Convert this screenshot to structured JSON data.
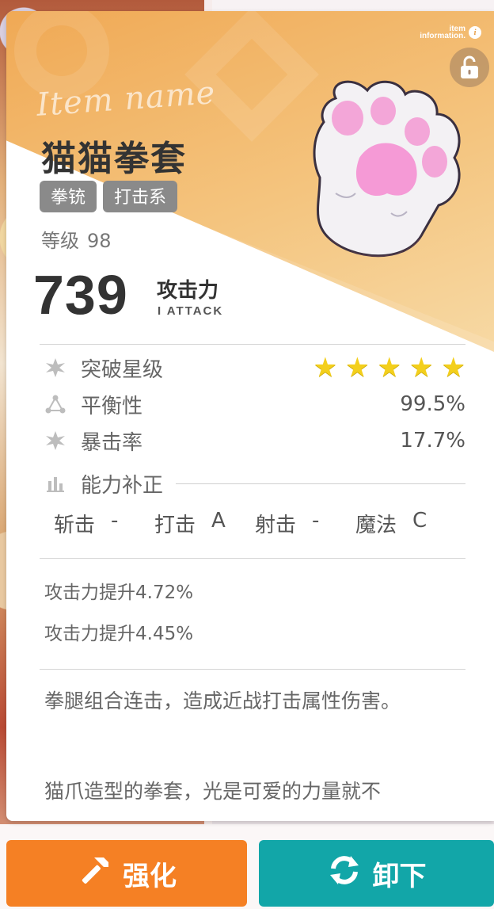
{
  "header": {
    "info_label_line1": "item",
    "info_label_line2": "information.",
    "info_icon": "i"
  },
  "item": {
    "script_label": "Item name",
    "name": "猫猫拳套",
    "tags": [
      "拳铳",
      "打击系"
    ],
    "level_label": "等级",
    "level_value": "98",
    "attack_value": "739",
    "attack_label": "攻击力",
    "attack_sublabel": "I ATTACK"
  },
  "stats": {
    "breakthrough_label": "突破星级",
    "stars": 5,
    "balance_label": "平衡性",
    "balance_value": "99.5%",
    "crit_label": "暴击率",
    "crit_value": "17.7%"
  },
  "correction": {
    "label": "能力补正",
    "items": [
      {
        "name": "斩击",
        "grade": "-"
      },
      {
        "name": "打击",
        "grade": "A"
      },
      {
        "name": "射击",
        "grade": "-"
      },
      {
        "name": "魔法",
        "grade": "C"
      }
    ]
  },
  "bonuses": [
    "攻击力提升4.72%",
    "攻击力提升4.45%"
  ],
  "description": {
    "line1": "拳腿组合连击，造成近战打击属性伤害。",
    "line2": "猫爪造型的拳套，光是可爱的力量就不"
  },
  "buttons": {
    "enhance": "强化",
    "unequip": "卸下"
  },
  "colors": {
    "header_orange": "#f0a955",
    "star_yellow": "#f3cf1c",
    "enhance_orange": "#f58024",
    "unequip_teal": "#12a6a8",
    "tag_gray": "#8a8a8a"
  },
  "icons": {
    "lock": "unlock-icon",
    "star_stat": "star-burst-icon",
    "balance": "triangle-nodes-icon",
    "crit": "star-burst-icon",
    "correction": "bar-chart-icon",
    "enhance": "hammer-icon",
    "unequip": "refresh-icon"
  }
}
